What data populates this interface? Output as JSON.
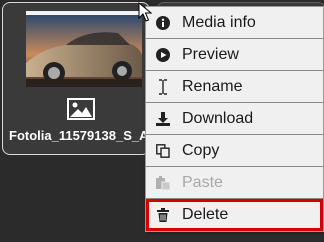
{
  "tile": {
    "filename": "Fotolia_11579138_S_A"
  },
  "menu": {
    "items": [
      {
        "label": "Media info",
        "icon": "info-icon"
      },
      {
        "label": "Preview",
        "icon": "play-icon"
      },
      {
        "label": "Rename",
        "icon": "text-cursor-icon"
      },
      {
        "label": "Download",
        "icon": "download-icon"
      },
      {
        "label": "Copy",
        "icon": "copy-icon"
      },
      {
        "label": "Paste",
        "icon": "paste-icon",
        "disabled": true
      },
      {
        "label": "Delete",
        "icon": "trash-icon",
        "highlighted": true
      }
    ]
  },
  "colors": {
    "highlight": "#d40000",
    "menu_bg": "#f0f0f0",
    "background": "#2b2b2b"
  }
}
